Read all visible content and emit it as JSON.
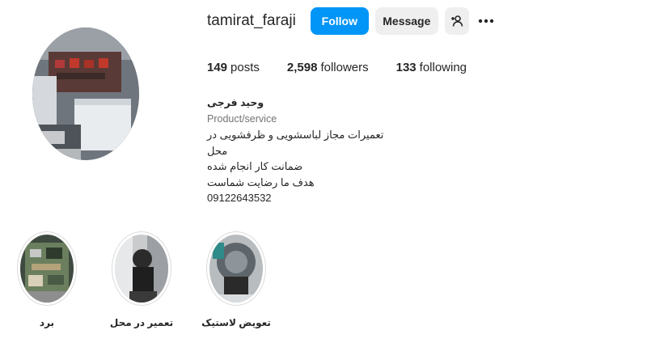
{
  "profile": {
    "username": "tamirat_faraji",
    "follow_label": "Follow",
    "message_label": "Message",
    "suggest_icon": "person-plus-icon",
    "more_icon": "more-dots-icon"
  },
  "stats": {
    "posts_count": "149",
    "posts_label": "posts",
    "followers_count": "2,598",
    "followers_label": "followers",
    "following_count": "133",
    "following_label": "following"
  },
  "bio": {
    "name": "وحید فرجی",
    "category": "Product/service",
    "lines": [
      "تعمیرات مجاز لباسشویی و ظرفشویی در محل",
      "ضمانت کار انجام شده",
      "هدف ما رضایت شماست",
      "09122643532"
    ]
  },
  "highlights": [
    {
      "label": "برد"
    },
    {
      "label": "تعمیر در محل"
    },
    {
      "label": "تعویض لاستیک"
    }
  ],
  "colors": {
    "accent": "#0095f6",
    "button_gray": "#efefef",
    "text": "#262626",
    "muted": "#737373"
  }
}
